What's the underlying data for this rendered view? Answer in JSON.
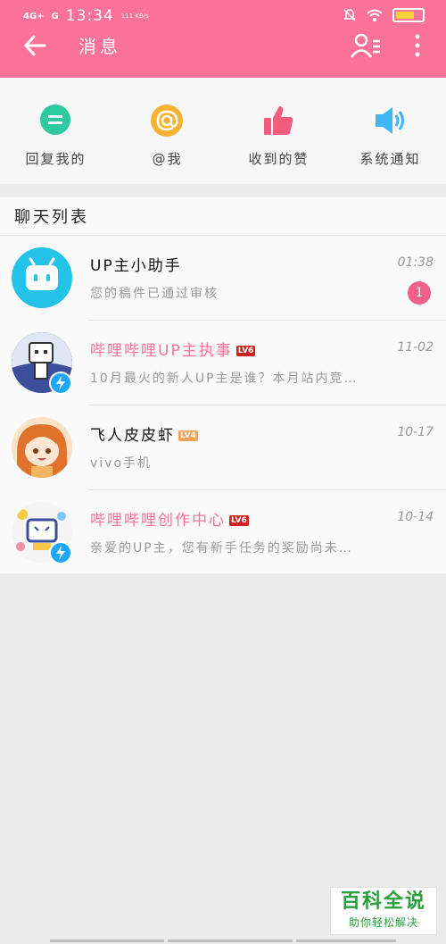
{
  "status_bar": {
    "signal": "4G+",
    "signal2": "G",
    "time": "13:34",
    "net_speed": "111 KB/s"
  },
  "header": {
    "title": "消息",
    "background_color": "#fb7299"
  },
  "quick_actions": [
    {
      "label": "回复我的",
      "icon": "reply-bubble-icon",
      "color": "#2dc9a0"
    },
    {
      "label": "@我",
      "icon": "at-icon",
      "color": "#f7b233"
    },
    {
      "label": "收到的赞",
      "icon": "thumbs-up-icon",
      "color": "#f25d7e"
    },
    {
      "label": "系统通知",
      "icon": "speaker-icon",
      "color": "#3cb8f5"
    }
  ],
  "chat_list": {
    "title": "聊天列表",
    "items": [
      {
        "name": "UP主小助手",
        "level": "",
        "time": "01:38",
        "preview": "您的稿件已通过审核",
        "unread": "1"
      },
      {
        "name": "哔哩哔哩UP主执事",
        "level": "LV6",
        "time": "11-02",
        "preview": "10月最火的新人UP主是谁？本月站内竞…",
        "unread": ""
      },
      {
        "name": "飞人皮皮虾",
        "level": "LV4",
        "time": "10-17",
        "preview": "vivo手机",
        "unread": ""
      },
      {
        "name": "哔哩哔哩创作中心",
        "level": "LV6",
        "time": "10-14",
        "preview": "亲爱的UP主，您有新手任务的奖励尚未…",
        "unread": ""
      }
    ]
  },
  "watermark": {
    "line1": "百科全说",
    "line2": "助你轻松解决"
  }
}
